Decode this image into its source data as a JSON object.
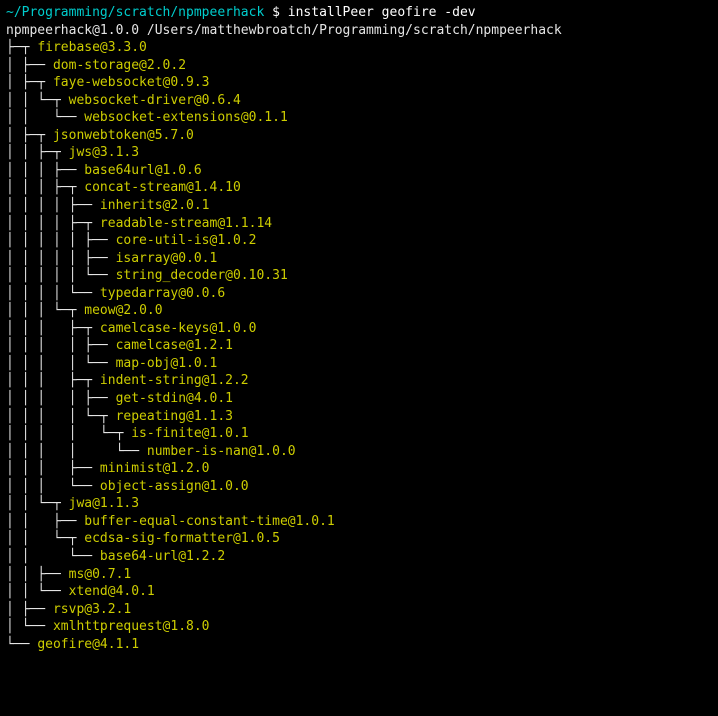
{
  "prompt": {
    "path": "~/Programming/scratch/npmpeerhack",
    "symbol": "$",
    "command": "installPeer geofire -dev"
  },
  "header": "npmpeerhack@1.0.0 /Users/matthewbroatch/Programming/scratch/npmpeerhack",
  "lines": [
    {
      "tree": "├─┬ ",
      "pkg": "firebase@3.3.0"
    },
    {
      "tree": "│ ├── ",
      "pkg": "dom-storage@2.0.2"
    },
    {
      "tree": "│ ├─┬ ",
      "pkg": "faye-websocket@0.9.3"
    },
    {
      "tree": "│ │ └─┬ ",
      "pkg": "websocket-driver@0.6.4"
    },
    {
      "tree": "│ │   └── ",
      "pkg": "websocket-extensions@0.1.1"
    },
    {
      "tree": "│ ├─┬ ",
      "pkg": "jsonwebtoken@5.7.0"
    },
    {
      "tree": "│ │ ├─┬ ",
      "pkg": "jws@3.1.3"
    },
    {
      "tree": "│ │ │ ├── ",
      "pkg": "base64url@1.0.6"
    },
    {
      "tree": "│ │ │ ├─┬ ",
      "pkg": "concat-stream@1.4.10"
    },
    {
      "tree": "│ │ │ │ ├── ",
      "pkg": "inherits@2.0.1"
    },
    {
      "tree": "│ │ │ │ ├─┬ ",
      "pkg": "readable-stream@1.1.14"
    },
    {
      "tree": "│ │ │ │ │ ├── ",
      "pkg": "core-util-is@1.0.2"
    },
    {
      "tree": "│ │ │ │ │ ├── ",
      "pkg": "isarray@0.0.1"
    },
    {
      "tree": "│ │ │ │ │ └── ",
      "pkg": "string_decoder@0.10.31"
    },
    {
      "tree": "│ │ │ │ └── ",
      "pkg": "typedarray@0.0.6"
    },
    {
      "tree": "│ │ │ └─┬ ",
      "pkg": "meow@2.0.0"
    },
    {
      "tree": "│ │ │   ├─┬ ",
      "pkg": "camelcase-keys@1.0.0"
    },
    {
      "tree": "│ │ │   │ ├── ",
      "pkg": "camelcase@1.2.1"
    },
    {
      "tree": "│ │ │   │ └── ",
      "pkg": "map-obj@1.0.1"
    },
    {
      "tree": "│ │ │   ├─┬ ",
      "pkg": "indent-string@1.2.2"
    },
    {
      "tree": "│ │ │   │ ├── ",
      "pkg": "get-stdin@4.0.1"
    },
    {
      "tree": "│ │ │   │ └─┬ ",
      "pkg": "repeating@1.1.3"
    },
    {
      "tree": "│ │ │   │   └─┬ ",
      "pkg": "is-finite@1.0.1"
    },
    {
      "tree": "│ │ │   │     └── ",
      "pkg": "number-is-nan@1.0.0"
    },
    {
      "tree": "│ │ │   ├── ",
      "pkg": "minimist@1.2.0"
    },
    {
      "tree": "│ │ │   └── ",
      "pkg": "object-assign@1.0.0"
    },
    {
      "tree": "│ │ └─┬ ",
      "pkg": "jwa@1.1.3"
    },
    {
      "tree": "│ │   ├── ",
      "pkg": "buffer-equal-constant-time@1.0.1"
    },
    {
      "tree": "│ │   └─┬ ",
      "pkg": "ecdsa-sig-formatter@1.0.5"
    },
    {
      "tree": "│ │     └── ",
      "pkg": "base64-url@1.2.2"
    },
    {
      "tree": "│ │ ├── ",
      "pkg": "ms@0.7.1"
    },
    {
      "tree": "│ │ └── ",
      "pkg": "xtend@4.0.1"
    },
    {
      "tree": "│ ├── ",
      "pkg": "rsvp@3.2.1"
    },
    {
      "tree": "│ └── ",
      "pkg": "xmlhttprequest@1.8.0"
    },
    {
      "tree": "└── ",
      "pkg": "geofire@4.1.1"
    }
  ]
}
